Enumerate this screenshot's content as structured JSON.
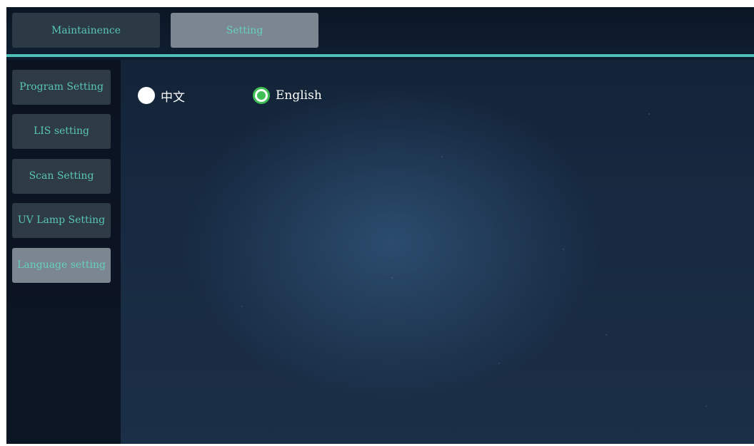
{
  "top_tabs": {
    "maintenance_label": "Maintainence",
    "setting_label": "Setting"
  },
  "sidebar": {
    "items": [
      {
        "label": "Program Setting"
      },
      {
        "label": "LIS setting"
      },
      {
        "label": "Scan Setting"
      },
      {
        "label": "UV Lamp Setting"
      },
      {
        "label": "Language setting"
      }
    ],
    "active_index": 4
  },
  "language": {
    "options": [
      {
        "label": "中文",
        "selected": false
      },
      {
        "label": "English",
        "selected": true
      }
    ]
  },
  "colors": {
    "accent": "#4fc0b8",
    "radio_selected": "#3fbf55",
    "button_text": "#58c6b8"
  }
}
